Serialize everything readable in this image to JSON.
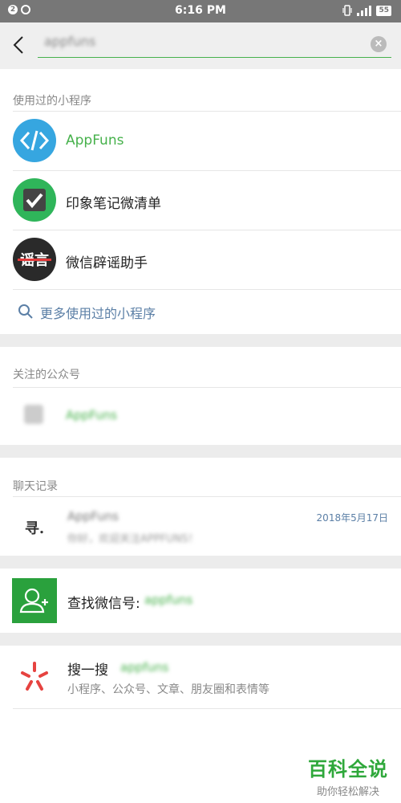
{
  "status_bar": {
    "notification_count": "2",
    "time": "6:16 PM",
    "battery": "55"
  },
  "search": {
    "query": "appfuns",
    "clear_icon": "clear-icon",
    "back_icon": "back-arrow-icon"
  },
  "mini_programs": {
    "title": "使用过的小程序",
    "items": [
      {
        "label": "AppFuns",
        "icon": "code-brackets-icon",
        "color": "#46b14b"
      },
      {
        "label": "印象笔记微清单",
        "icon": "checkmark-icon"
      },
      {
        "label": "微信辟谣助手",
        "icon": "rumor-icon",
        "icon_text": "谣言"
      }
    ],
    "more_label": "更多使用过的小程序"
  },
  "official_accounts": {
    "title": "关注的公众号",
    "item_label": "AppFuns"
  },
  "chat_history": {
    "title": "聊天记录",
    "name": "AppFuns",
    "snippet": "你好，欢迎关注APPFUNS！",
    "date": "2018年5月17日",
    "avatar_text": "寻."
  },
  "find_wechat_id": {
    "label": "查找微信号:",
    "value": "appfuns"
  },
  "search_search": {
    "label": "搜一搜",
    "query": "appfuns",
    "subtitle": "小程序、公众号、文章、朋友圈和表情等"
  },
  "watermark": {
    "title": "百科全说",
    "subtitle": "助你轻松解决"
  },
  "colors": {
    "accent_green": "#46b14b",
    "status_gray": "#777777"
  }
}
